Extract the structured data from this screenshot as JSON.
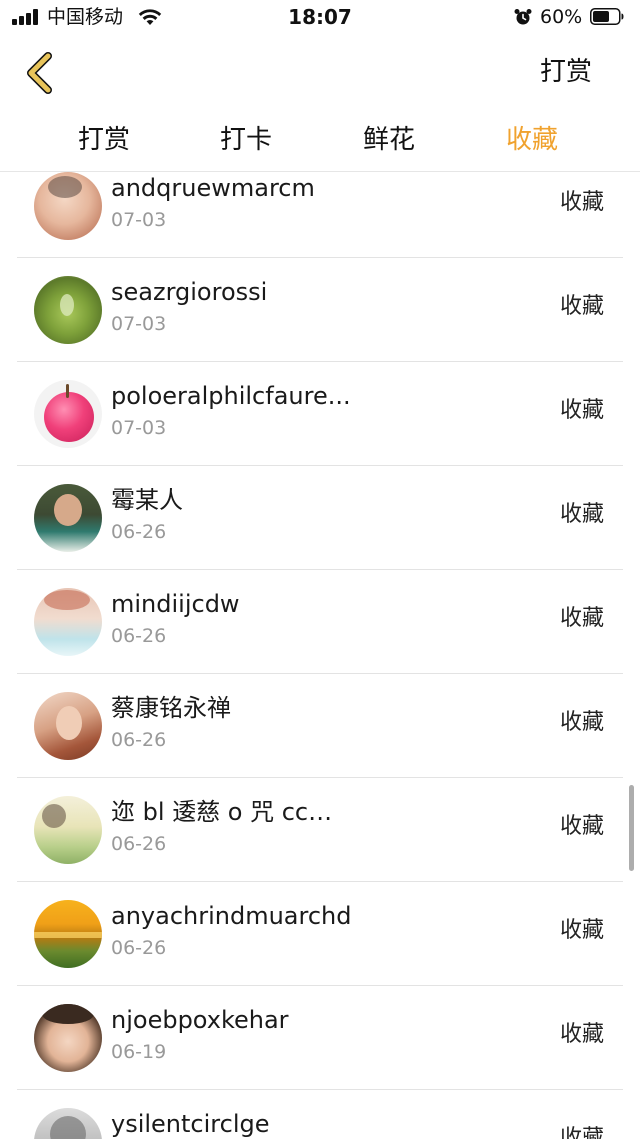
{
  "status_bar": {
    "carrier": "中国移动",
    "time": "18:07",
    "battery": "60%",
    "icons": [
      "signal-icon",
      "wifi-icon",
      "alarm-icon",
      "battery-icon"
    ]
  },
  "header": {
    "back_icon": "chevron-left-icon",
    "action_label": "打赏"
  },
  "tabs": [
    {
      "label": "打赏",
      "active": false
    },
    {
      "label": "打卡",
      "active": false
    },
    {
      "label": "鲜花",
      "active": false
    },
    {
      "label": "收藏",
      "active": true
    }
  ],
  "colors": {
    "accent": "#F0A22E",
    "text": "#111111",
    "date": "#999999",
    "divider": "#e3e3e3",
    "back_icon": "#E8C45A"
  },
  "list": {
    "items": [
      {
        "name": "andqruewmarcm",
        "date": "07-03",
        "action": "收藏"
      },
      {
        "name": "seazrgiorossi",
        "date": "07-03",
        "action": "收藏"
      },
      {
        "name": "poloeralphilcfaure...",
        "date": "07-03",
        "action": "收藏"
      },
      {
        "name": "霉某人",
        "date": "06-26",
        "action": "收藏"
      },
      {
        "name": "mindiijcdw",
        "date": "06-26",
        "action": "收藏"
      },
      {
        "name": "蔡康铭永禅",
        "date": "06-26",
        "action": "收藏"
      },
      {
        "name": "迩 bl 逶慈 o 咒 cc…",
        "date": "06-26",
        "action": "收藏"
      },
      {
        "name": "anyachrindmuarchd",
        "date": "06-26",
        "action": "收藏"
      },
      {
        "name": "njoebpoxkehar",
        "date": "06-19",
        "action": "收藏"
      },
      {
        "name": "ysilentcirclge",
        "date": "",
        "action": "收藏"
      }
    ]
  }
}
